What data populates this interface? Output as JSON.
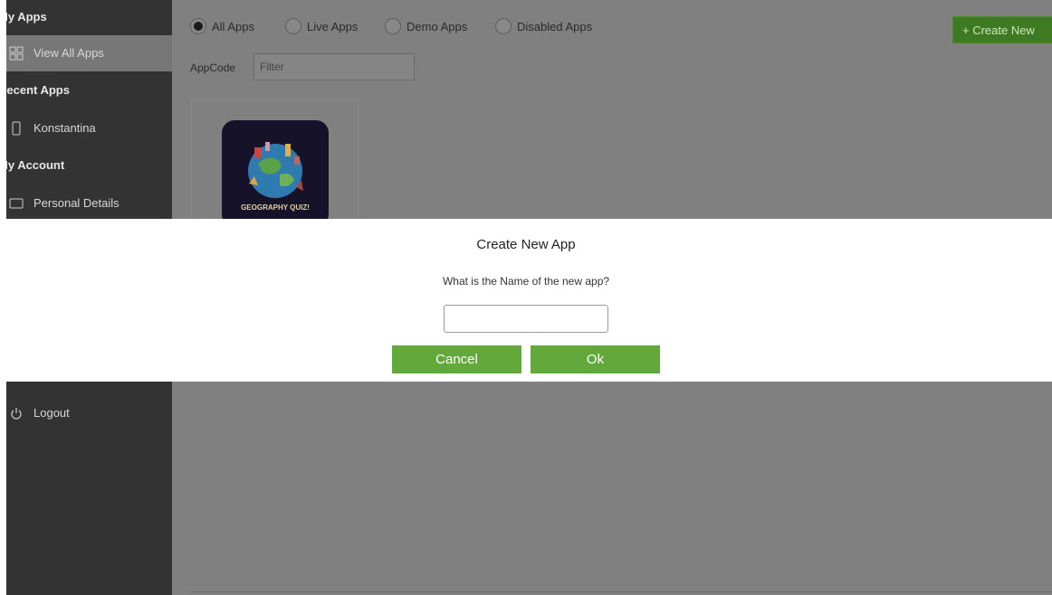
{
  "sidebar": {
    "my_apps_header": "My Apps",
    "view_all_apps": "View All Apps",
    "recent_apps_header": "Recent Apps",
    "recent_app": "Konstantina",
    "my_account_header": "My Account",
    "personal_details": "Personal Details",
    "logout": "Logout"
  },
  "filters": {
    "options": [
      "All Apps",
      "Live Apps",
      "Demo Apps",
      "Disabled Apps"
    ],
    "selected": "All Apps"
  },
  "create_button": "+ Create New",
  "appcode": {
    "label": "AppCode",
    "placeholder": "Filter"
  },
  "app_card": {
    "icon_text": "GEOGRAPHY QUIZ!"
  },
  "modal": {
    "title": "Create New App",
    "question": "What is the Name of the new app?",
    "input_value": "",
    "cancel_label": "Cancel",
    "ok_label": "Ok"
  },
  "colors": {
    "sidebar_bg": "#333333",
    "overlay": "#808080",
    "modal_button": "#63a83a",
    "create_button_dim": "#3e7a22"
  }
}
